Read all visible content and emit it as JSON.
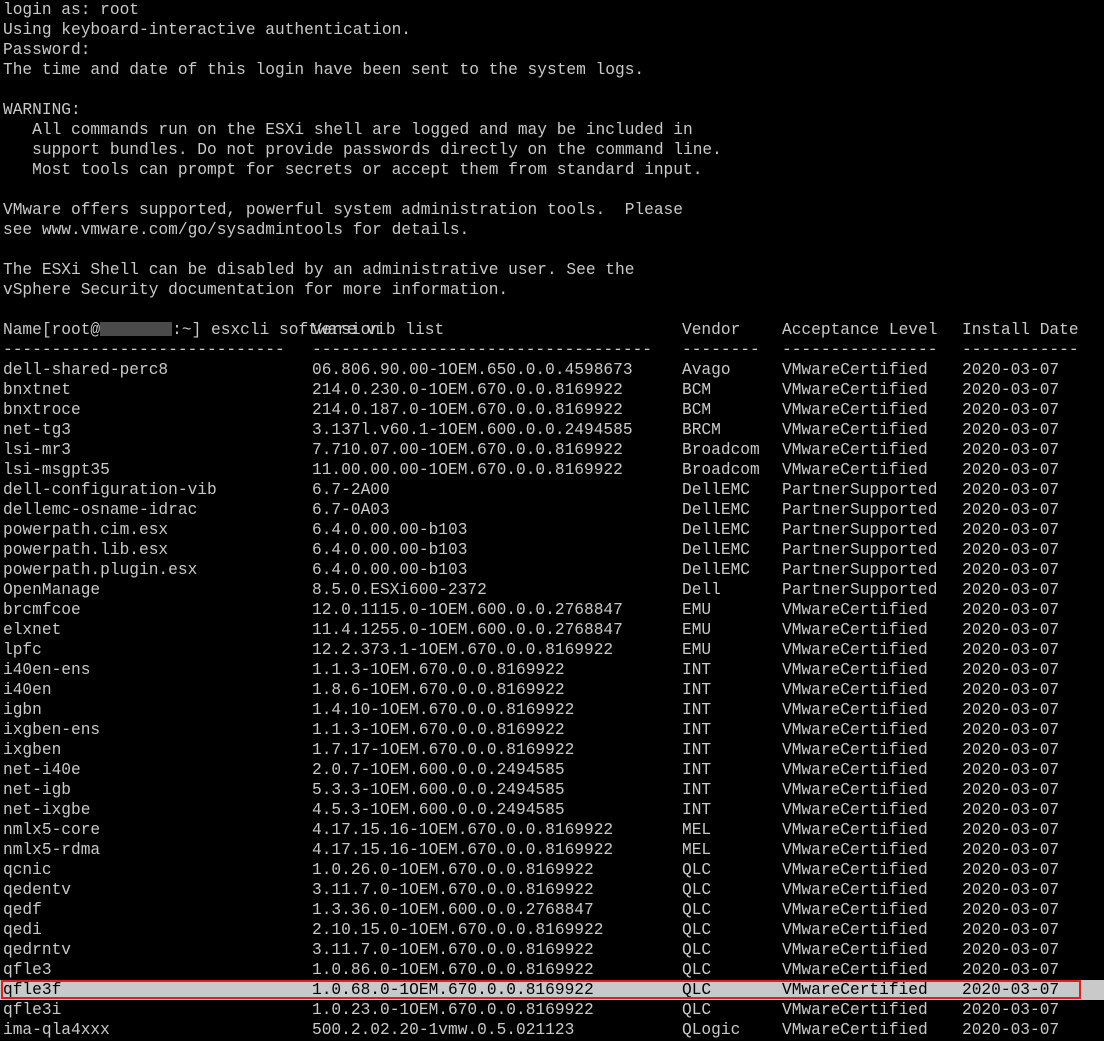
{
  "session": {
    "lines": [
      "login as: root",
      "Using keyboard-interactive authentication.",
      "Password:",
      "The time and date of this login have been sent to the system logs.",
      "",
      "WARNING:",
      "   All commands run on the ESXi shell are logged and may be included in",
      "   support bundles. Do not provide passwords directly on the command line.",
      "   Most tools can prompt for secrets or accept them from standard input.",
      "",
      "VMware offers supported, powerful system administration tools.  Please",
      "see www.vmware.com/go/sysadmintools for details.",
      "",
      "The ESXi Shell can be disabled by an administrative user. See the",
      "vSphere Security documentation for more information."
    ],
    "prompt_prefix": "[root@",
    "prompt_suffix": ":~] ",
    "command": "esxcli software vib list"
  },
  "table": {
    "headers": {
      "name": "Name",
      "version": "Version",
      "vendor": "Vendor",
      "acceptance": "Acceptance Level",
      "date": "Install Date"
    },
    "separators": {
      "name": "-----------------------------",
      "version": "-----------------------------------",
      "vendor": "--------",
      "acceptance": "----------------",
      "date": "------------"
    },
    "rows": [
      {
        "name": "dell-shared-perc8",
        "version": "06.806.90.00-1OEM.650.0.0.4598673",
        "vendor": "Avago",
        "acceptance": "VMwareCertified",
        "date": "2020-03-07"
      },
      {
        "name": "bnxtnet",
        "version": "214.0.230.0-1OEM.670.0.0.8169922",
        "vendor": "BCM",
        "acceptance": "VMwareCertified",
        "date": "2020-03-07"
      },
      {
        "name": "bnxtroce",
        "version": "214.0.187.0-1OEM.670.0.0.8169922",
        "vendor": "BCM",
        "acceptance": "VMwareCertified",
        "date": "2020-03-07"
      },
      {
        "name": "net-tg3",
        "version": "3.137l.v60.1-1OEM.600.0.0.2494585",
        "vendor": "BRCM",
        "acceptance": "VMwareCertified",
        "date": "2020-03-07"
      },
      {
        "name": "lsi-mr3",
        "version": "7.710.07.00-1OEM.670.0.0.8169922",
        "vendor": "Broadcom",
        "acceptance": "VMwareCertified",
        "date": "2020-03-07"
      },
      {
        "name": "lsi-msgpt35",
        "version": "11.00.00.00-1OEM.670.0.0.8169922",
        "vendor": "Broadcom",
        "acceptance": "VMwareCertified",
        "date": "2020-03-07"
      },
      {
        "name": "dell-configuration-vib",
        "version": "6.7-2A00",
        "vendor": "DellEMC",
        "acceptance": "PartnerSupported",
        "date": "2020-03-07"
      },
      {
        "name": "dellemc-osname-idrac",
        "version": "6.7-0A03",
        "vendor": "DellEMC",
        "acceptance": "PartnerSupported",
        "date": "2020-03-07"
      },
      {
        "name": "powerpath.cim.esx",
        "version": "6.4.0.00.00-b103",
        "vendor": "DellEMC",
        "acceptance": "PartnerSupported",
        "date": "2020-03-07"
      },
      {
        "name": "powerpath.lib.esx",
        "version": "6.4.0.00.00-b103",
        "vendor": "DellEMC",
        "acceptance": "PartnerSupported",
        "date": "2020-03-07"
      },
      {
        "name": "powerpath.plugin.esx",
        "version": "6.4.0.00.00-b103",
        "vendor": "DellEMC",
        "acceptance": "PartnerSupported",
        "date": "2020-03-07"
      },
      {
        "name": "OpenManage",
        "version": "8.5.0.ESXi600-2372",
        "vendor": "Dell",
        "acceptance": "PartnerSupported",
        "date": "2020-03-07"
      },
      {
        "name": "brcmfcoe",
        "version": "12.0.1115.0-1OEM.600.0.0.2768847",
        "vendor": "EMU",
        "acceptance": "VMwareCertified",
        "date": "2020-03-07"
      },
      {
        "name": "elxnet",
        "version": "11.4.1255.0-1OEM.600.0.0.2768847",
        "vendor": "EMU",
        "acceptance": "VMwareCertified",
        "date": "2020-03-07"
      },
      {
        "name": "lpfc",
        "version": "12.2.373.1-1OEM.670.0.0.8169922",
        "vendor": "EMU",
        "acceptance": "VMwareCertified",
        "date": "2020-03-07"
      },
      {
        "name": "i40en-ens",
        "version": "1.1.3-1OEM.670.0.0.8169922",
        "vendor": "INT",
        "acceptance": "VMwareCertified",
        "date": "2020-03-07"
      },
      {
        "name": "i40en",
        "version": "1.8.6-1OEM.670.0.0.8169922",
        "vendor": "INT",
        "acceptance": "VMwareCertified",
        "date": "2020-03-07"
      },
      {
        "name": "igbn",
        "version": "1.4.10-1OEM.670.0.0.8169922",
        "vendor": "INT",
        "acceptance": "VMwareCertified",
        "date": "2020-03-07"
      },
      {
        "name": "ixgben-ens",
        "version": "1.1.3-1OEM.670.0.0.8169922",
        "vendor": "INT",
        "acceptance": "VMwareCertified",
        "date": "2020-03-07"
      },
      {
        "name": "ixgben",
        "version": "1.7.17-1OEM.670.0.0.8169922",
        "vendor": "INT",
        "acceptance": "VMwareCertified",
        "date": "2020-03-07"
      },
      {
        "name": "net-i40e",
        "version": "2.0.7-1OEM.600.0.0.2494585",
        "vendor": "INT",
        "acceptance": "VMwareCertified",
        "date": "2020-03-07"
      },
      {
        "name": "net-igb",
        "version": "5.3.3-1OEM.600.0.0.2494585",
        "vendor": "INT",
        "acceptance": "VMwareCertified",
        "date": "2020-03-07"
      },
      {
        "name": "net-ixgbe",
        "version": "4.5.3-1OEM.600.0.0.2494585",
        "vendor": "INT",
        "acceptance": "VMwareCertified",
        "date": "2020-03-07"
      },
      {
        "name": "nmlx5-core",
        "version": "4.17.15.16-1OEM.670.0.0.8169922",
        "vendor": "MEL",
        "acceptance": "VMwareCertified",
        "date": "2020-03-07"
      },
      {
        "name": "nmlx5-rdma",
        "version": "4.17.15.16-1OEM.670.0.0.8169922",
        "vendor": "MEL",
        "acceptance": "VMwareCertified",
        "date": "2020-03-07"
      },
      {
        "name": "qcnic",
        "version": "1.0.26.0-1OEM.670.0.0.8169922",
        "vendor": "QLC",
        "acceptance": "VMwareCertified",
        "date": "2020-03-07"
      },
      {
        "name": "qedentv",
        "version": "3.11.7.0-1OEM.670.0.0.8169922",
        "vendor": "QLC",
        "acceptance": "VMwareCertified",
        "date": "2020-03-07"
      },
      {
        "name": "qedf",
        "version": "1.3.36.0-1OEM.600.0.0.2768847",
        "vendor": "QLC",
        "acceptance": "VMwareCertified",
        "date": "2020-03-07"
      },
      {
        "name": "qedi",
        "version": "2.10.15.0-1OEM.670.0.0.8169922",
        "vendor": "QLC",
        "acceptance": "VMwareCertified",
        "date": "2020-03-07"
      },
      {
        "name": "qedrntv",
        "version": "3.11.7.0-1OEM.670.0.0.8169922",
        "vendor": "QLC",
        "acceptance": "VMwareCertified",
        "date": "2020-03-07"
      },
      {
        "name": "qfle3",
        "version": "1.0.86.0-1OEM.670.0.0.8169922",
        "vendor": "QLC",
        "acceptance": "VMwareCertified",
        "date": "2020-03-07"
      },
      {
        "name": "qfle3f",
        "version": "1.0.68.0-1OEM.670.0.0.8169922",
        "vendor": "QLC",
        "acceptance": "VMwareCertified",
        "date": "2020-03-07",
        "highlighted": true
      },
      {
        "name": "qfle3i",
        "version": "1.0.23.0-1OEM.670.0.0.8169922",
        "vendor": "QLC",
        "acceptance": "VMwareCertified",
        "date": "2020-03-07"
      },
      {
        "name": "ima-qla4xxx",
        "version": "500.2.02.20-1vmw.0.5.021123",
        "vendor": "QLogic",
        "acceptance": "VMwareCertified",
        "date": "2020-03-07"
      }
    ]
  },
  "colors": {
    "background": "#000000",
    "text": "#c9c9c9",
    "selection": "#c9c9c9",
    "selection_text": "#000000",
    "annotation_box": "#e02020"
  }
}
